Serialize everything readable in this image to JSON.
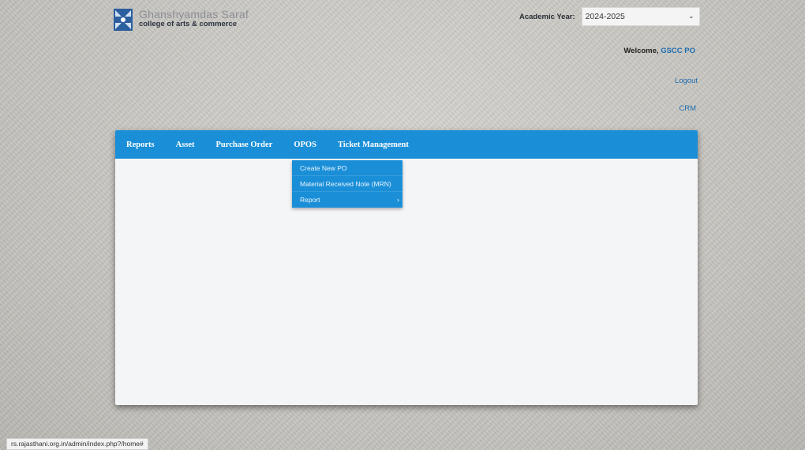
{
  "logo": {
    "name": "Ghanshyamdas Saraf",
    "subtitle": "college of arts & commerce"
  },
  "academic_year": {
    "label": "Academic Year:",
    "value": "2024-2025"
  },
  "user": {
    "welcome_prefix": "Welcome,",
    "name": "GSCC PO",
    "logout_label": "Logout",
    "crm_label": "CRM"
  },
  "nav": {
    "items": [
      {
        "label": "Reports"
      },
      {
        "label": "Asset"
      },
      {
        "label": "Purchase Order"
      },
      {
        "label": "OPOS"
      },
      {
        "label": "Ticket Management"
      }
    ],
    "active_menu": "OPOS"
  },
  "dropdown": {
    "items": [
      {
        "label": "Create New PO"
      },
      {
        "label": "Material Received Note (MRN)"
      },
      {
        "label": "Report",
        "has_submenu": true
      }
    ]
  },
  "status_bar": {
    "url": "rs.rajasthani.org.in/admin/index.php?/home#"
  },
  "colors": {
    "accent": "#1a8fd8",
    "link": "#1f6fb0",
    "panel_bg": "#f4f5f6"
  }
}
